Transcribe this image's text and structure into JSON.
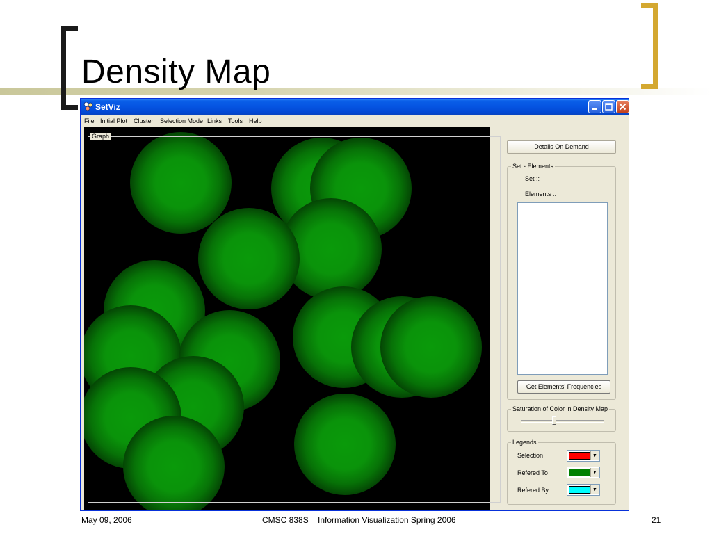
{
  "slide": {
    "title": "Density Map",
    "footer": {
      "date": "May 09, 2006",
      "course": "CMSC 838S    Information Visualization Spring 2006",
      "page_number": "21"
    }
  },
  "window": {
    "title": "SetViz",
    "menu": [
      "File",
      "Initial Plot",
      "Cluster",
      "Selection Mode",
      "Links",
      "Tools",
      "Help"
    ]
  },
  "graph": {
    "label": "Graph",
    "blob_color": "#0a9a0a",
    "background_color": "#000000"
  },
  "panel": {
    "details_button": "Details On Demand",
    "set_elements": {
      "group_label": "Set - Elements",
      "set_label": "Set ::",
      "elements_label": "Elements ::",
      "frequencies_button": "Get Elements' Frequencies"
    },
    "saturation": {
      "group_label": "Saturation of Color in Density Map",
      "value_fraction": 0.4
    },
    "legends": {
      "group_label": "Legends",
      "items": [
        {
          "label": "Selection",
          "color": "#ff0000"
        },
        {
          "label": "Refered To",
          "color": "#008000"
        },
        {
          "label": "Refered By",
          "color": "#00ffff"
        }
      ]
    }
  }
}
